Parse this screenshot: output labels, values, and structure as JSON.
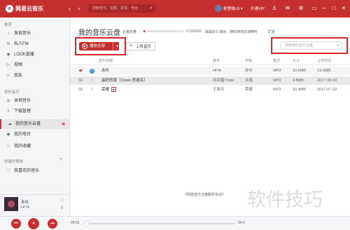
{
  "app": {
    "logo_glyph": "e",
    "name": "网易云音乐"
  },
  "header": {
    "back": "‹",
    "forward": "›",
    "search_placeholder": "搜索音乐，视频，歌词，电台",
    "user_name": "依里桃LB",
    "vip_label": "开通VIP",
    "dropdown": "▾",
    "icons": [
      "shirt-icon",
      "mail-icon",
      "gear-icon",
      "mini-mode-icon",
      "minimize-icon",
      "maximize-icon",
      "close-icon"
    ],
    "icon_glyphs": [
      "♙",
      "✉",
      "⚙",
      "▭",
      "–",
      "□",
      "✕"
    ]
  },
  "sidebar": {
    "section_recommend": "推荐",
    "recommend_items": [
      {
        "icon": "♪",
        "label": "发现音乐"
      },
      {
        "icon": "≋",
        "label": "私人FM"
      },
      {
        "icon": "◉",
        "label": "LOOK直播"
      },
      {
        "icon": "▷",
        "label": "视频"
      },
      {
        "icon": "☺",
        "label": "朋友"
      }
    ],
    "section_my_music": "我的音乐",
    "my_items": [
      {
        "icon": "◎",
        "label": "本地音乐"
      },
      {
        "icon": "⇩",
        "label": "下载管理"
      },
      {
        "icon": "☁",
        "label": "我的音乐云盘"
      },
      {
        "icon": "◉",
        "label": "我的电台"
      },
      {
        "icon": "☆",
        "label": "我的收藏"
      }
    ],
    "section_playlists": "创建的歌单",
    "playlist_items": [
      {
        "icon": "♡",
        "label": "我喜欢的音乐"
      }
    ],
    "add_glyph": "+",
    "volume_glyph": "◀)"
  },
  "cloud": {
    "title": "我的音乐云盘",
    "capacity_label": "云盘容量",
    "capacity_used_fraction": 0.01,
    "capacity_value": "0.1G/60G",
    "note": "歌曲永久保存，随时随地多端畅听",
    "expand_link": "扩容",
    "play_all_label": "播放全部",
    "play_all_plus": "+",
    "upload_label": "上传音乐",
    "search_placeholder": "搜索我的音乐云盘"
  },
  "table": {
    "headers": [
      "音乐标题",
      "歌手",
      "专辑",
      "格式",
      "大小",
      "上传时间"
    ],
    "rows": [
      {
        "index": "",
        "title": "赤伶",
        "mv": "",
        "artist": "HITA",
        "album": "赤伶",
        "format": "MP3",
        "size": "10.5MB",
        "time": "13:08前"
      },
      {
        "index": "02",
        "title": "最好的我（Cover 房祖名）",
        "mv": "",
        "artist": "特亚腊Triste",
        "album": "合唱",
        "format": "MP3",
        "size": "4.8MB",
        "time": "2017-08-18"
      },
      {
        "index": "03",
        "title": "荣耀",
        "mv": "▶",
        "artist": "王晓天",
        "album": "荣耀",
        "format": "MP3",
        "size": "10.4MB",
        "time": "2017-07-22"
      }
    ]
  },
  "agreement_link": "《网易音乐云盘服务协议》",
  "now_playing": {
    "song": "赤伶",
    "artist": "HITA"
  },
  "player": {
    "prev": "⏮",
    "pause": "⏸",
    "next": "⏭",
    "current_time": "00:01",
    "total_time": "04:2",
    "progress_fraction": 0.02
  },
  "watermark": "软件技巧"
}
